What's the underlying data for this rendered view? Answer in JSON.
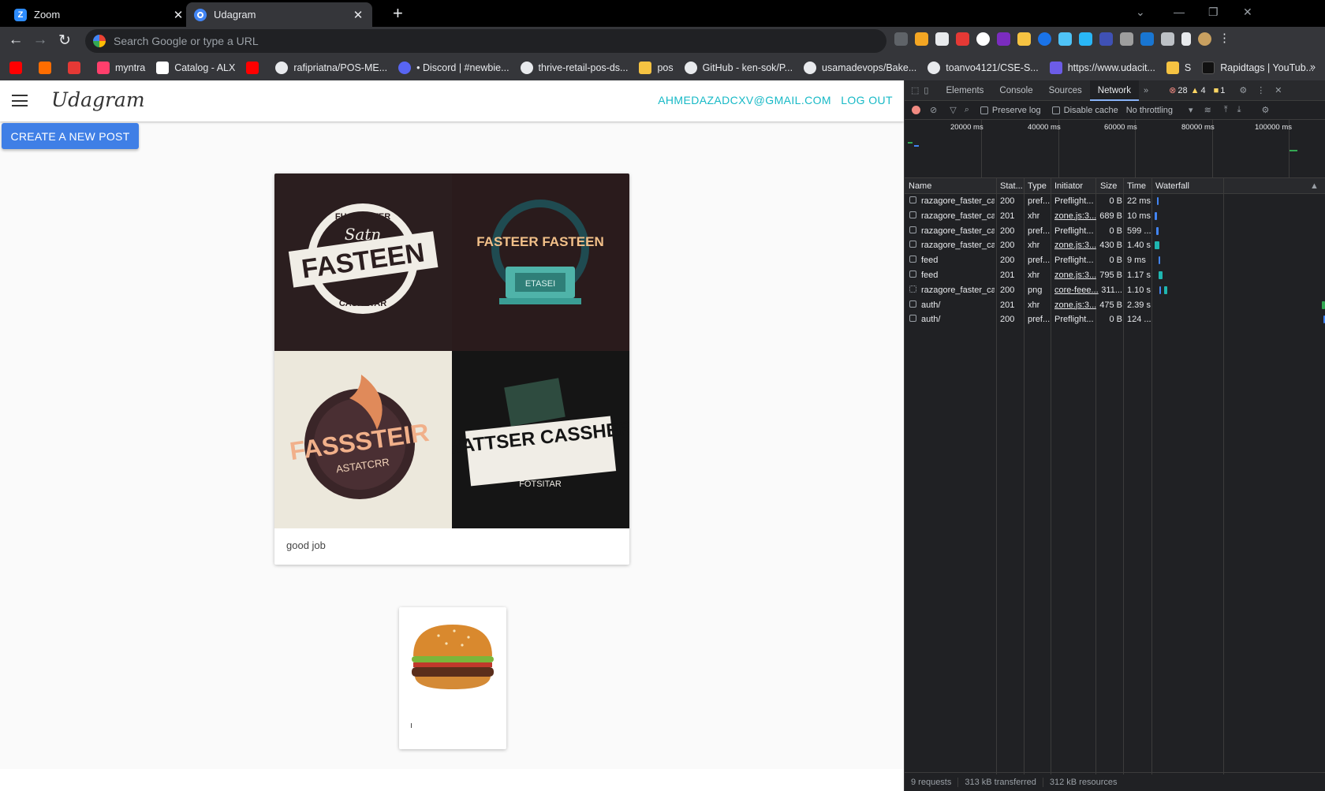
{
  "browser": {
    "tabs": [
      {
        "title": "Zoom",
        "favicon": "zoom-icon",
        "color": "#2d8cff",
        "active": false
      },
      {
        "title": "Udagram",
        "favicon": "globe-icon",
        "color": "#4285f4",
        "active": true
      }
    ],
    "omnibox_placeholder": "Search Google or type a URL",
    "bookmarks": [
      {
        "label": "",
        "icon": "youtube-icon",
        "color": "#ff0000"
      },
      {
        "label": "",
        "icon": "orange-square-icon",
        "color": "#ff6d00"
      },
      {
        "label": "",
        "icon": "red-flag-icon",
        "color": "#e53935"
      },
      {
        "label": "myntra",
        "icon": "myntra-icon",
        "color": "#ff3f6c"
      },
      {
        "label": "Catalog - ALX",
        "icon": "alx-icon",
        "color": "#ffffff"
      },
      {
        "label": "",
        "icon": "youtube-icon",
        "color": "#ff0000"
      },
      {
        "label": "rafipriatna/POS-ME...",
        "icon": "github-icon",
        "color": "#e8eaed"
      },
      {
        "label": "• Discord | #newbie...",
        "icon": "discord-icon",
        "color": "#5865f2"
      },
      {
        "label": "thrive-retail-pos-ds...",
        "icon": "github-icon",
        "color": "#e8eaed"
      },
      {
        "label": "pos",
        "icon": "folder-icon",
        "color": "#f6c342"
      },
      {
        "label": "GitHub - ken-sok/P...",
        "icon": "github-icon",
        "color": "#e8eaed"
      },
      {
        "label": "usamadevops/Bake...",
        "icon": "github-icon",
        "color": "#e8eaed"
      },
      {
        "label": "toanvo4121/CSE-S...",
        "icon": "github-icon",
        "color": "#e8eaed"
      },
      {
        "label": "https://www.udacit...",
        "icon": "udacity-icon",
        "color": "#6c5ce7"
      },
      {
        "label": "S",
        "icon": "folder-icon",
        "color": "#f6c342"
      },
      {
        "label": "Rapidtags | YouTub...",
        "icon": "rapidtags-icon",
        "color": "#000000"
      }
    ]
  },
  "app": {
    "brand": "Udagram",
    "user_email": "AHMEDAZADCXV@GMAIL.COM",
    "logout_label": "LOG OUT",
    "create_post_label": "CREATE A NEW POST",
    "posts": [
      {
        "caption": "good job",
        "logos": [
          {
            "top": "FH CASSTER",
            "script": "Satn",
            "main": "FASTEEN",
            "bottom": "CASRETAR"
          },
          {
            "main": "FASTEER FASTEEN",
            "box": "ETASEI"
          },
          {
            "main": "FASSSTEIR",
            "sub": "ASTATCRR"
          },
          {
            "main": "MATTSER CASSHER",
            "sub": "FOTSITAR"
          }
        ]
      },
      {
        "caption": "ı",
        "image": "hamburger-image"
      }
    ]
  },
  "devtools": {
    "tabs": [
      "Elements",
      "Console",
      "Sources",
      "Network"
    ],
    "active_tab": "Network",
    "errors": "28",
    "warnings": "4",
    "issues": "1",
    "preserve_log": "Preserve log",
    "disable_cache": "Disable cache",
    "throttling": "No throttling",
    "timeline_ticks": [
      "20000 ms",
      "40000 ms",
      "60000 ms",
      "80000 ms",
      "100000 ms"
    ],
    "columns": [
      "Name",
      "Stat...",
      "Type",
      "Initiator",
      "Size",
      "Time",
      "Waterfall"
    ],
    "requests": [
      {
        "name": "razagore_faster_ca...",
        "status": "200",
        "type": "pref...",
        "initiator": "Preflight...",
        "size": "0 B",
        "time": "22 ms"
      },
      {
        "name": "razagore_faster_ca...",
        "status": "201",
        "type": "xhr",
        "initiator": "zone.js:3...",
        "size": "689 B",
        "time": "10 ms"
      },
      {
        "name": "razagore_faster_ca...",
        "status": "200",
        "type": "pref...",
        "initiator": "Preflight...",
        "size": "0 B",
        "time": "599 ..."
      },
      {
        "name": "razagore_faster_ca...",
        "status": "200",
        "type": "xhr",
        "initiator": "zone.js:3...",
        "size": "430 B",
        "time": "1.40 s"
      },
      {
        "name": "feed",
        "status": "200",
        "type": "pref...",
        "initiator": "Preflight...",
        "size": "0 B",
        "time": "9 ms"
      },
      {
        "name": "feed",
        "status": "201",
        "type": "xhr",
        "initiator": "zone.js:3...",
        "size": "795 B",
        "time": "1.17 s"
      },
      {
        "name": "razagore_faster_ca...",
        "status": "200",
        "type": "png",
        "initiator": "core-feee...",
        "size": "311...",
        "time": "1.10 s"
      },
      {
        "name": "auth/",
        "status": "201",
        "type": "xhr",
        "initiator": "zone.js:3...",
        "size": "475 B",
        "time": "2.39 s"
      },
      {
        "name": "auth/",
        "status": "200",
        "type": "pref...",
        "initiator": "Preflight...",
        "size": "0 B",
        "time": "124 ..."
      }
    ],
    "summary": {
      "requests": "9 requests",
      "transferred": "313 kB transferred",
      "resources": "312 kB resources"
    }
  }
}
